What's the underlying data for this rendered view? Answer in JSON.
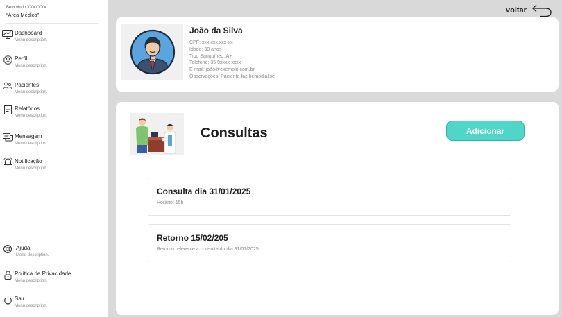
{
  "sidebar": {
    "welcome": "Bem vindo XXXXXXX",
    "area": "“Área Médico”",
    "items": [
      {
        "label": "Dashboard",
        "desc": "Menu description.",
        "icon": "dashboard-icon"
      },
      {
        "label": "Perfil",
        "desc": "Menu description.",
        "icon": "user-icon"
      },
      {
        "label": "Pacientes",
        "desc": "Menu description.",
        "icon": "patients-icon"
      },
      {
        "label": "Relatórios",
        "desc": "Menu description.",
        "icon": "report-icon"
      },
      {
        "label": "Mensagem",
        "desc": "Menu description.",
        "icon": "message-icon"
      },
      {
        "label": "Notificação",
        "desc": "Menu description.",
        "icon": "bell-icon"
      }
    ],
    "bottom_items": [
      {
        "label": "Ajuda",
        "desc": "Menu description.",
        "icon": "help-icon"
      },
      {
        "label": "Política de Privacidade",
        "desc": "Menu description.",
        "icon": "lock-icon"
      },
      {
        "label": "Sair",
        "desc": "Menu description.",
        "icon": "power-icon"
      }
    ]
  },
  "header": {
    "back_label": "voltar"
  },
  "patient": {
    "name": "João da Silva",
    "cpf": "CPF: xxx.xxx.xxx-xx",
    "age": "Idade: 30 anos",
    "blood": "Tipo Sanguíneo: A+",
    "phone": "Telefone: 35 9xxxx-xxxx",
    "email": "E-mail: joão@exemplo.com.br",
    "notes": "Observações: Paciente faz hemodialise"
  },
  "consultas": {
    "title": "Consultas",
    "add_label": "Adicionar",
    "items": [
      {
        "title": "Consulta dia 31/01/2025",
        "subtitle": "Horário: 15h"
      },
      {
        "title": "Retorno 15/02/205",
        "subtitle": "Retorno referente a consulta do dia 31/01/2025"
      }
    ]
  },
  "colors": {
    "accent": "#4fd6c8",
    "background": "#d9d9d9",
    "card": "#ffffff"
  }
}
